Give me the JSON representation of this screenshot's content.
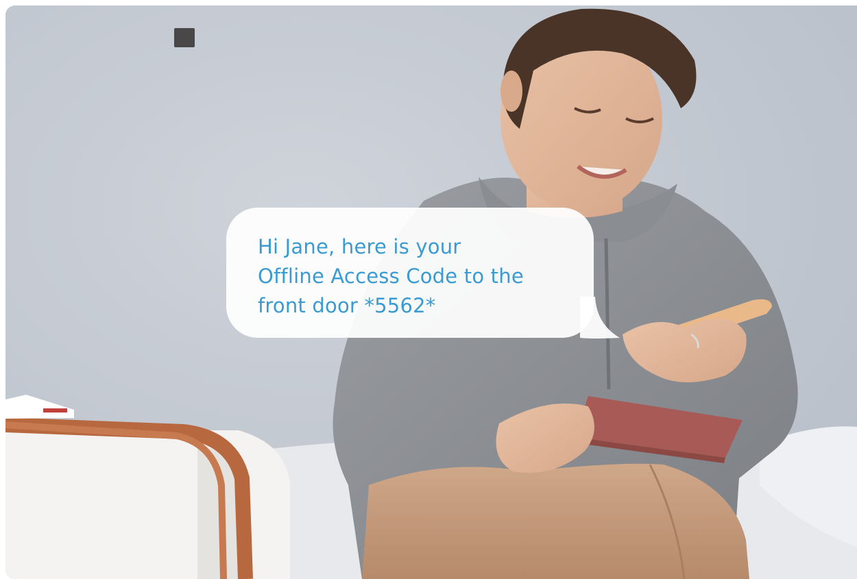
{
  "message": {
    "text": "Hi Jane, here is your Offline Access Code to the front door *5562*",
    "color": "#3a9bd2"
  },
  "scene": {
    "wall_color": "#c3c8d1",
    "hoodie_color": "#8b8e92",
    "phone_color": "#e9b98a",
    "passport_color": "#a85b56",
    "bag_color": "#c39a7c",
    "suitcase_color": "#f4f3f1",
    "strap_color": "#b8683e"
  }
}
